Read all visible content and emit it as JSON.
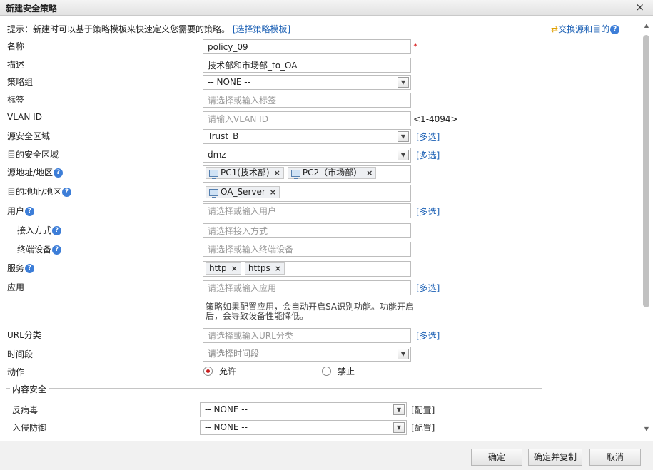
{
  "dialog": {
    "title": "新建安全策略",
    "close_glyph": "×"
  },
  "hint": {
    "text": "提示：新建时可以基于策略模板来快速定义您需要的策略。",
    "link": "[选择策略模板]"
  },
  "swap": {
    "label": "交换源和目的"
  },
  "help_glyph": "?",
  "form": {
    "name": {
      "label": "名称",
      "value": "policy_09",
      "required_mark": "*"
    },
    "description": {
      "label": "描述",
      "value": "技术部和市场部_to_OA"
    },
    "policy_group": {
      "label": "策略组",
      "value": "-- NONE --"
    },
    "tag": {
      "label": "标签",
      "placeholder": "请选择或输入标签"
    },
    "vlan": {
      "label": "VLAN ID",
      "placeholder": "请输入VLAN ID",
      "range": "<1-4094>"
    },
    "src_zone": {
      "label": "源安全区域",
      "value": "Trust_B",
      "multi": "[多选]"
    },
    "dst_zone": {
      "label": "目的安全区域",
      "value": "dmz",
      "multi": "[多选]"
    },
    "src_addr": {
      "label": "源地址/地区",
      "tags": [
        "PC1(技术部)",
        "PC2（市场部）"
      ]
    },
    "dst_addr": {
      "label": "目的地址/地区",
      "tags": [
        "OA_Server"
      ]
    },
    "user": {
      "label": "用户",
      "placeholder": "请选择或输入用户",
      "multi": "[多选]"
    },
    "access_mode": {
      "label": "接入方式",
      "placeholder": "请选择接入方式"
    },
    "terminal": {
      "label": "终端设备",
      "placeholder": "请选择或输入终端设备"
    },
    "service": {
      "label": "服务",
      "tags": [
        "http",
        "https"
      ]
    },
    "application": {
      "label": "应用",
      "placeholder": "请选择或输入应用",
      "multi": "[多选]",
      "note": "策略如果配置应用，会自动开启SA识别功能。功能开启后，会导致设备性能降低。"
    },
    "url_category": {
      "label": "URL分类",
      "placeholder": "请选择或输入URL分类",
      "multi": "[多选]"
    },
    "time_range": {
      "label": "时间段",
      "placeholder": "请选择时间段"
    },
    "action": {
      "label": "动作",
      "options": [
        "允许",
        "禁止"
      ],
      "selected": "允许"
    }
  },
  "content_security": {
    "legend": "内容安全",
    "antivirus": {
      "label": "反病毒",
      "value": "-- NONE --",
      "config": "[配置]"
    },
    "ips": {
      "label": "入侵防御",
      "value": "-- NONE --",
      "config": "[配置]"
    }
  },
  "footer": {
    "ok": "确定",
    "ok_copy": "确定并复制",
    "cancel": "取消"
  },
  "colors": {
    "link": "#1a5fb4",
    "required": "#d40000",
    "radio_selected": "#c81e1e",
    "help_icon": "#3d7ed8"
  }
}
